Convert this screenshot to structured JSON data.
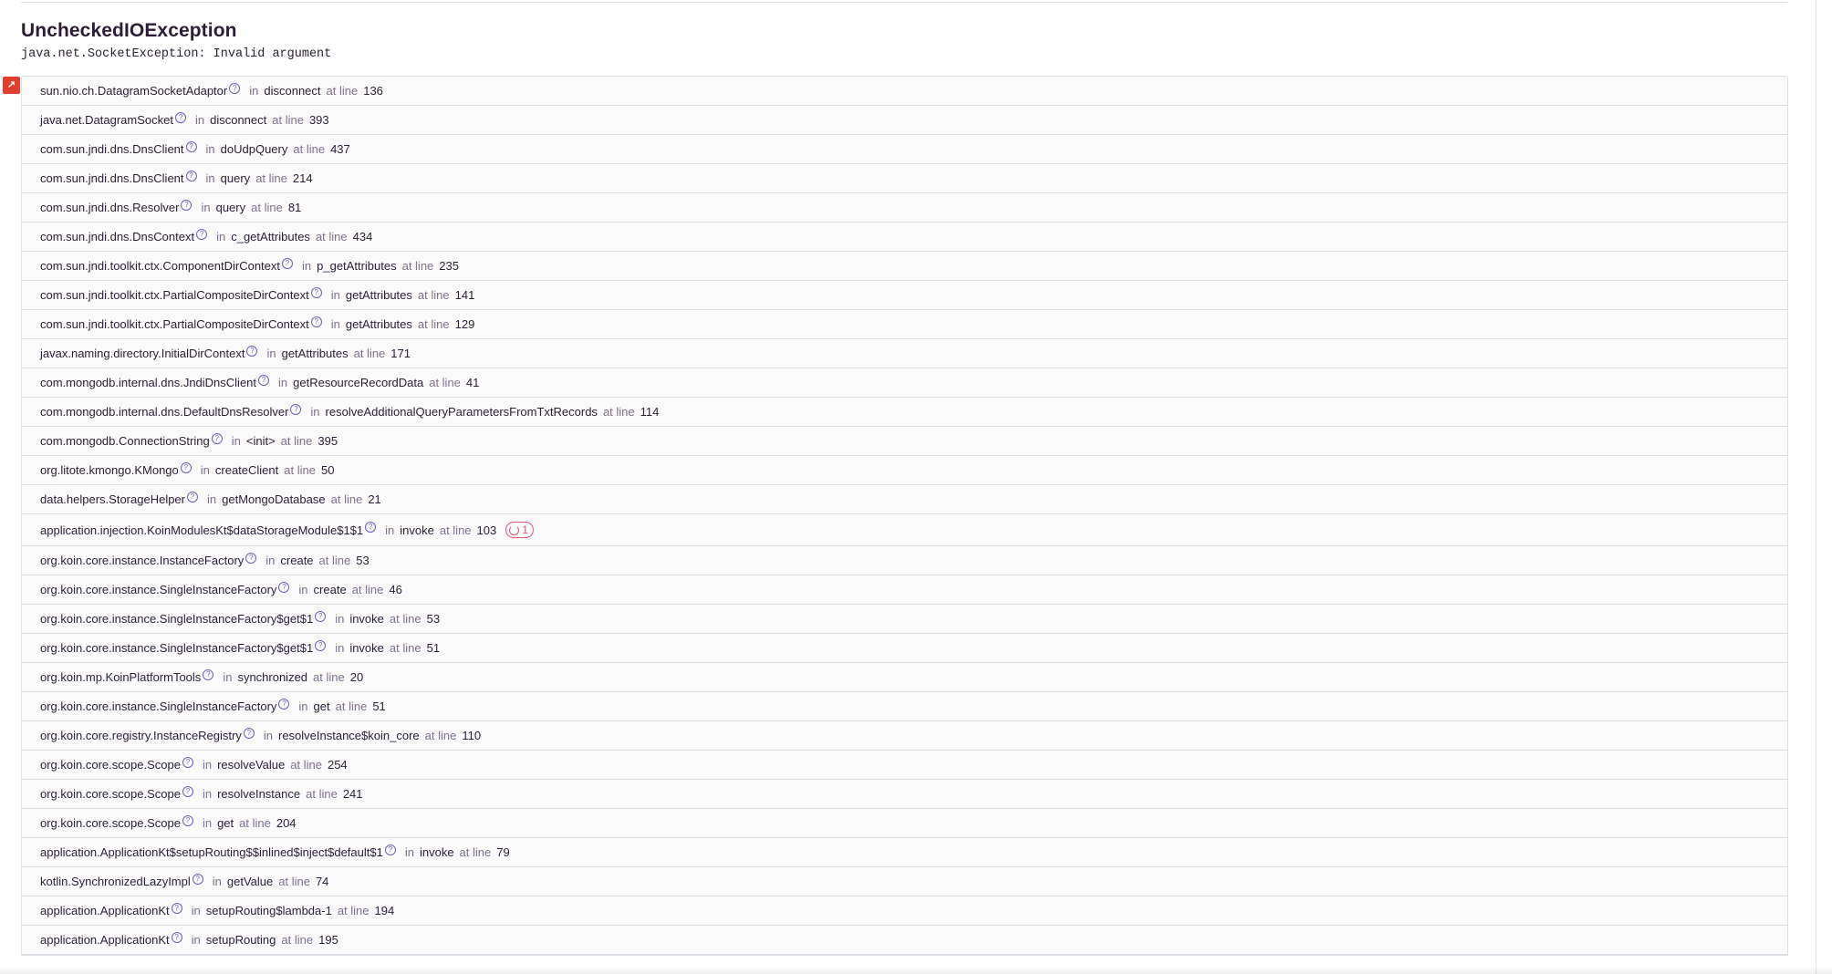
{
  "exception": {
    "type": "UncheckedIOException",
    "message": "java.net.SocketException: Invalid argument"
  },
  "labels": {
    "in": "in",
    "at_line": "at line",
    "info_glyph": "?",
    "marker_glyph": "↗"
  },
  "colors": {
    "accent": "#6c5fc7",
    "repeat": "#e1567c",
    "marker": "#e03e2f"
  },
  "frames": [
    {
      "module": "sun.nio.ch.DatagramSocketAdaptor",
      "function": "disconnect",
      "line": "136"
    },
    {
      "module": "java.net.DatagramSocket",
      "function": "disconnect",
      "line": "393"
    },
    {
      "module": "com.sun.jndi.dns.DnsClient",
      "function": "doUdpQuery",
      "line": "437"
    },
    {
      "module": "com.sun.jndi.dns.DnsClient",
      "function": "query",
      "line": "214"
    },
    {
      "module": "com.sun.jndi.dns.Resolver",
      "function": "query",
      "line": "81"
    },
    {
      "module": "com.sun.jndi.dns.DnsContext",
      "function": "c_getAttributes",
      "line": "434"
    },
    {
      "module": "com.sun.jndi.toolkit.ctx.ComponentDirContext",
      "function": "p_getAttributes",
      "line": "235"
    },
    {
      "module": "com.sun.jndi.toolkit.ctx.PartialCompositeDirContext",
      "function": "getAttributes",
      "line": "141"
    },
    {
      "module": "com.sun.jndi.toolkit.ctx.PartialCompositeDirContext",
      "function": "getAttributes",
      "line": "129"
    },
    {
      "module": "javax.naming.directory.InitialDirContext",
      "function": "getAttributes",
      "line": "171"
    },
    {
      "module": "com.mongodb.internal.dns.JndiDnsClient",
      "function": "getResourceRecordData",
      "line": "41"
    },
    {
      "module": "com.mongodb.internal.dns.DefaultDnsResolver",
      "function": "resolveAdditionalQueryParametersFromTxtRecords",
      "line": "114"
    },
    {
      "module": "com.mongodb.ConnectionString",
      "function": "<init>",
      "line": "395"
    },
    {
      "module": "org.litote.kmongo.KMongo",
      "function": "createClient",
      "line": "50"
    },
    {
      "module": "data.helpers.StorageHelper",
      "function": "getMongoDatabase",
      "line": "21"
    },
    {
      "module": "application.injection.KoinModulesKt$dataStorageModule$1$1",
      "function": "invoke",
      "line": "103",
      "repeats": "1"
    },
    {
      "module": "org.koin.core.instance.InstanceFactory",
      "function": "create",
      "line": "53"
    },
    {
      "module": "org.koin.core.instance.SingleInstanceFactory",
      "function": "create",
      "line": "46"
    },
    {
      "module": "org.koin.core.instance.SingleInstanceFactory$get$1",
      "function": "invoke",
      "line": "53"
    },
    {
      "module": "org.koin.core.instance.SingleInstanceFactory$get$1",
      "function": "invoke",
      "line": "51"
    },
    {
      "module": "org.koin.mp.KoinPlatformTools",
      "function": "synchronized",
      "line": "20"
    },
    {
      "module": "org.koin.core.instance.SingleInstanceFactory",
      "function": "get",
      "line": "51"
    },
    {
      "module": "org.koin.core.registry.InstanceRegistry",
      "function": "resolveInstance$koin_core",
      "line": "110"
    },
    {
      "module": "org.koin.core.scope.Scope",
      "function": "resolveValue",
      "line": "254"
    },
    {
      "module": "org.koin.core.scope.Scope",
      "function": "resolveInstance",
      "line": "241"
    },
    {
      "module": "org.koin.core.scope.Scope",
      "function": "get",
      "line": "204"
    },
    {
      "module": "application.ApplicationKt$setupRouting$$inlined$inject$default$1",
      "function": "invoke",
      "line": "79"
    },
    {
      "module": "kotlin.SynchronizedLazyImpl",
      "function": "getValue",
      "line": "74"
    },
    {
      "module": "application.ApplicationKt",
      "function": "setupRouting$lambda-1",
      "line": "194"
    },
    {
      "module": "application.ApplicationKt",
      "function": "setupRouting",
      "line": "195"
    }
  ]
}
